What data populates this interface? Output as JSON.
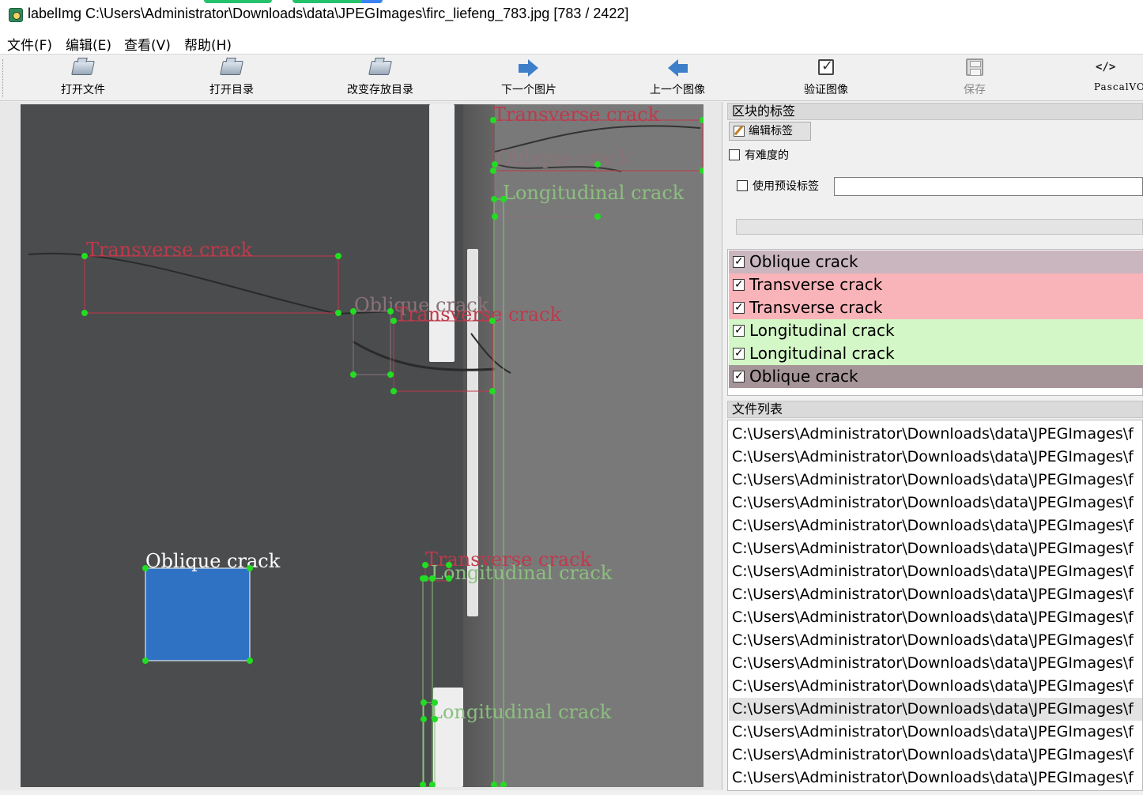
{
  "window": {
    "title": "labelImg C:\\Users\\Administrator\\Downloads\\data\\JPEGImages\\firc_liefeng_783.jpg [783 / 2422]"
  },
  "menu": [
    "文件(F)",
    "编辑(E)",
    "查看(V)",
    "帮助(H)"
  ],
  "toolbar": {
    "open_file": "打开文件",
    "open_dir": "打开目录",
    "change_save_dir": "改变存放目录",
    "next_image": "下一个图片",
    "prev_image": "上一个图像",
    "verify_image": "验证图像",
    "save": "保存",
    "format": "PascalVO"
  },
  "canvas": {
    "annotations": [
      {
        "label": "Transverse crack",
        "color": "#c0394b"
      },
      {
        "label": "Oblique crack",
        "color": "#8a7378"
      },
      {
        "label": "Longitudinal crack",
        "color": "#8bbf7f"
      },
      {
        "label": "Transverse crack",
        "color": "#c0394b"
      },
      {
        "label": "Oblique crack",
        "color": "#8a7378"
      },
      {
        "label": "Transverse crack",
        "color": "#c0394b"
      },
      {
        "label": "Oblique crack",
        "color": "#ffffff"
      },
      {
        "label": "Transverse crack",
        "color": "#c0394b"
      },
      {
        "label": "Longitudinal crack",
        "color": "#8bbf7f"
      },
      {
        "label": "Longitudinal crack",
        "color": "#8bbf7f"
      }
    ]
  },
  "dock": {
    "box_labels_title": "区块的标签",
    "edit_label_button": "编辑标签",
    "difficult_label": "有难度的",
    "use_default_label": "使用预设标签",
    "default_label_value": "",
    "file_list_title": "文件列表"
  },
  "label_list": [
    {
      "text": "Oblique crack",
      "bg": "#c9b6be",
      "checked": true
    },
    {
      "text": "Transverse crack",
      "bg": "#f9b4b9",
      "checked": true
    },
    {
      "text": "Transverse crack",
      "bg": "#f9b4b9",
      "checked": true
    },
    {
      "text": "Longitudinal crack",
      "bg": "#d3f7c6",
      "checked": true
    },
    {
      "text": "Longitudinal crack",
      "bg": "#d3f7c6",
      "checked": true
    },
    {
      "text": "Oblique crack",
      "bg": "#a59498",
      "checked": true
    }
  ],
  "file_list": {
    "selected_index": 12,
    "items": [
      "C:\\Users\\Administrator\\Downloads\\data\\JPEGImages\\f",
      "C:\\Users\\Administrator\\Downloads\\data\\JPEGImages\\f",
      "C:\\Users\\Administrator\\Downloads\\data\\JPEGImages\\f",
      "C:\\Users\\Administrator\\Downloads\\data\\JPEGImages\\f",
      "C:\\Users\\Administrator\\Downloads\\data\\JPEGImages\\f",
      "C:\\Users\\Administrator\\Downloads\\data\\JPEGImages\\f",
      "C:\\Users\\Administrator\\Downloads\\data\\JPEGImages\\f",
      "C:\\Users\\Administrator\\Downloads\\data\\JPEGImages\\f",
      "C:\\Users\\Administrator\\Downloads\\data\\JPEGImages\\f",
      "C:\\Users\\Administrator\\Downloads\\data\\JPEGImages\\f",
      "C:\\Users\\Administrator\\Downloads\\data\\JPEGImages\\f",
      "C:\\Users\\Administrator\\Downloads\\data\\JPEGImages\\f",
      "C:\\Users\\Administrator\\Downloads\\data\\JPEGImages\\f",
      "C:\\Users\\Administrator\\Downloads\\data\\JPEGImages\\f",
      "C:\\Users\\Administrator\\Downloads\\data\\JPEGImages\\f",
      "C:\\Users\\Administrator\\Downloads\\data\\JPEGImages\\f"
    ]
  }
}
